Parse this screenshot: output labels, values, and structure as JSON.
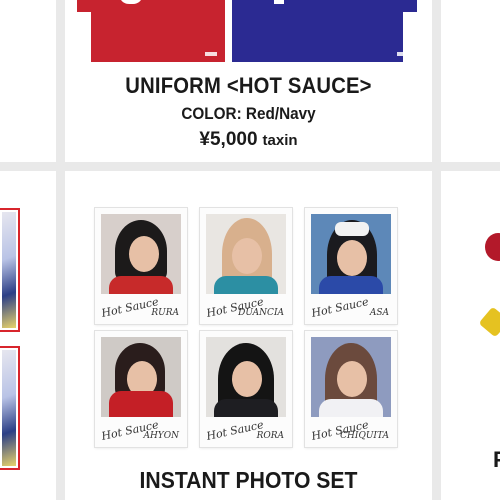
{
  "uniform": {
    "name": "UNIFORM <HOT SAUCE>",
    "color": "COLOR: Red/Navy",
    "price": "¥5,000",
    "tax": "taxin",
    "colors": {
      "red": "#c7232f",
      "navy": "#2b2a92"
    }
  },
  "photo_set": {
    "title": "INSTANT PHOTO SET",
    "photos": [
      {
        "signature": "Hot Sauce",
        "member": "RURA"
      },
      {
        "signature": "Hot Sauce",
        "member": "DUANCIA"
      },
      {
        "signature": "Hot Sauce",
        "member": "ASA"
      },
      {
        "signature": "Hot Sauce",
        "member": "AHYON"
      },
      {
        "signature": "Hot Sauce",
        "member": "RORA"
      },
      {
        "signature": "Hot Sauce",
        "member": "CHIQUITA"
      }
    ]
  }
}
